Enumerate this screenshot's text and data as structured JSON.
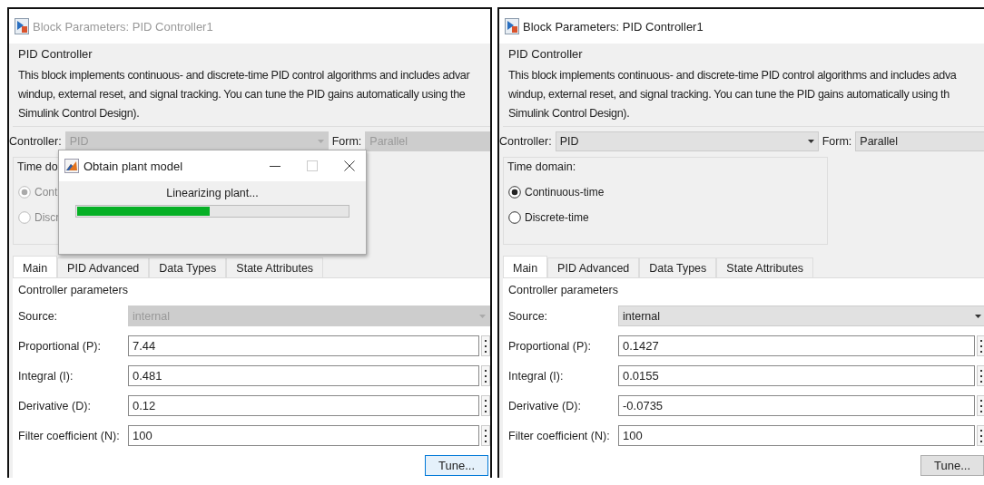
{
  "dialogs": [
    {
      "disabled": true,
      "title": "Block Parameters: PID Controller1",
      "heading": "PID Controller",
      "description_lines": [
        "This block implements continuous- and discrete-time PID control algorithms and includes advar",
        "windup, external reset, and signal tracking. You can tune the PID gains automatically using the",
        "Simulink Control Design)."
      ],
      "controller": {
        "label": "Controller:",
        "value": "PID"
      },
      "form": {
        "label": "Form:",
        "value": "Parallel"
      },
      "time_domain": {
        "label": "Time do",
        "options": [
          {
            "label": "Cont",
            "selected": true
          },
          {
            "label": "Discr",
            "selected": false
          }
        ]
      },
      "tabs": [
        {
          "label": "Main",
          "selected": true
        },
        {
          "label": "PID Advanced",
          "selected": false
        },
        {
          "label": "Data Types",
          "selected": false
        },
        {
          "label": "State Attributes",
          "selected": false
        }
      ],
      "section": "Controller parameters",
      "source": {
        "label": "Source:",
        "value": "internal"
      },
      "parameters": [
        {
          "label": "Proportional (P):",
          "value": "7.44"
        },
        {
          "label": "Integral (I):",
          "value": "0.481"
        },
        {
          "label": "Derivative (D):",
          "value": "0.12"
        },
        {
          "label": "Filter coefficient (N):",
          "value": "100"
        }
      ],
      "tune_button": {
        "label": "Tune...",
        "focused": true
      },
      "popup": {
        "title": "Obtain plant model",
        "message": "Linearizing plant...",
        "level": 0.49
      }
    },
    {
      "disabled": false,
      "title": "Block Parameters: PID Controller1",
      "heading": "PID Controller",
      "description_lines": [
        "This block implements continuous- and discrete-time PID control algorithms and includes adva",
        "windup, external reset, and signal tracking. You can tune the PID gains automatically using th",
        "Simulink Control Design)."
      ],
      "controller": {
        "label": "Controller:",
        "value": "PID"
      },
      "form": {
        "label": "Form:",
        "value": "Parallel"
      },
      "time_domain": {
        "label": "Time domain:",
        "options": [
          {
            "label": "Continuous-time",
            "selected": true
          },
          {
            "label": "Discrete-time",
            "selected": false
          }
        ]
      },
      "tabs": [
        {
          "label": "Main",
          "selected": true
        },
        {
          "label": "PID Advanced",
          "selected": false
        },
        {
          "label": "Data Types",
          "selected": false
        },
        {
          "label": "State Attributes",
          "selected": false
        }
      ],
      "section": "Controller parameters",
      "source": {
        "label": "Source:",
        "value": "internal"
      },
      "parameters": [
        {
          "label": "Proportional (P):",
          "value": "0.1427"
        },
        {
          "label": "Integral (I):",
          "value": "0.0155"
        },
        {
          "label": "Derivative (D):",
          "value": "-0.0735"
        },
        {
          "label": "Filter coefficient (N):",
          "value": "100"
        }
      ],
      "tune_button": {
        "label": "Tune...",
        "focused": false
      }
    }
  ]
}
